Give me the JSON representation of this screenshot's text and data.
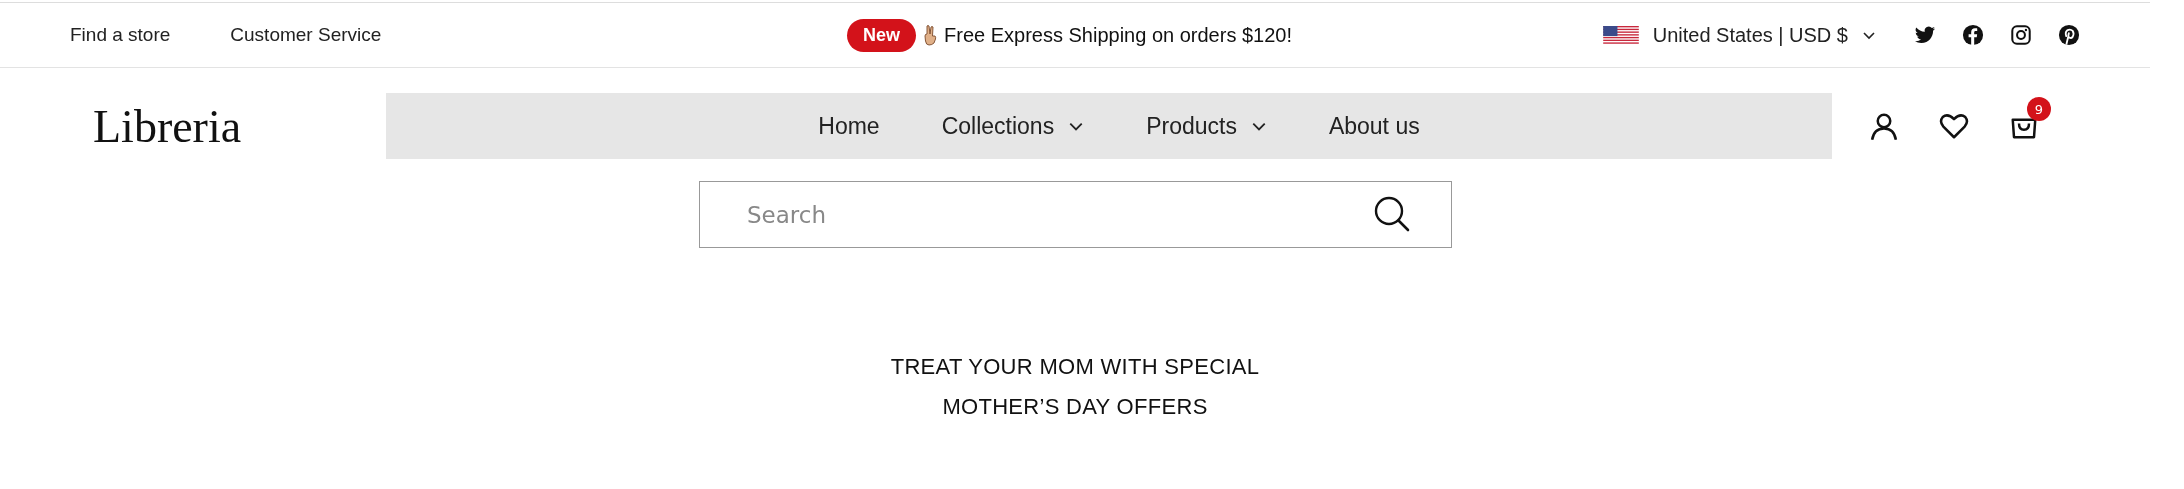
{
  "top_bar": {
    "links": [
      "Find a store",
      "Customer Service"
    ],
    "badge": "New",
    "promo": "Free Express Shipping on orders $120!",
    "locale": "United States | USD $"
  },
  "header": {
    "logo": "Libreria",
    "nav": [
      {
        "label": "Home",
        "has_menu": false
      },
      {
        "label": "Collections",
        "has_menu": true
      },
      {
        "label": "Products",
        "has_menu": true
      },
      {
        "label": "About us",
        "has_menu": false
      }
    ],
    "cart_count": "9"
  },
  "search": {
    "placeholder": "Search"
  },
  "headline": [
    "TREAT YOUR MOM WITH SPECIAL",
    "MOTHER’S DAY OFFERS"
  ]
}
